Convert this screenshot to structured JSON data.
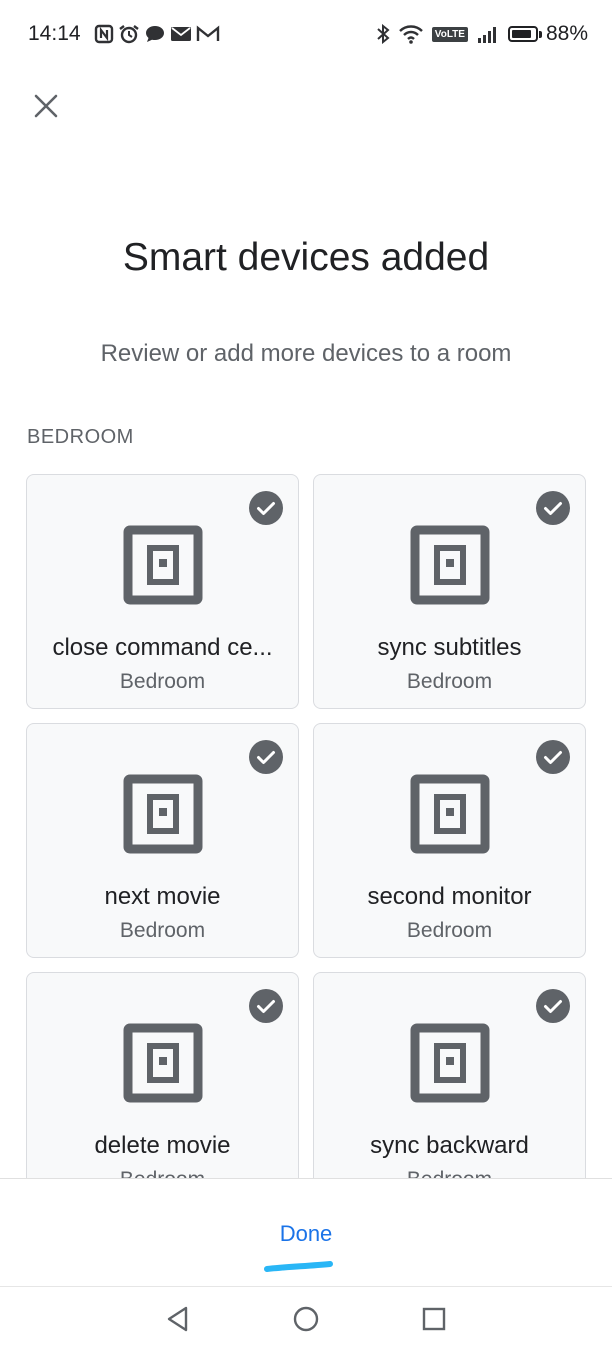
{
  "status_bar": {
    "time": "14:14",
    "left_icons": [
      "nfc-icon",
      "alarm-icon",
      "chat-icon",
      "mail-icon",
      "gmail-icon"
    ],
    "right_icons": [
      "bluetooth-icon",
      "wifi-icon",
      "volte-icon",
      "signal-icon",
      "battery-icon"
    ],
    "volte_label": "VoLTE",
    "battery_percent": "88%",
    "battery_level": 0.88
  },
  "header": {
    "close_icon": "close-icon",
    "title": "Smart devices added",
    "subtitle": "Review or add more devices to a room"
  },
  "section": {
    "label": "BEDROOM"
  },
  "devices": [
    {
      "name": "close command ce...",
      "room": "Bedroom",
      "checked": true
    },
    {
      "name": "sync subtitles",
      "room": "Bedroom",
      "checked": true
    },
    {
      "name": "next movie",
      "room": "Bedroom",
      "checked": true
    },
    {
      "name": "second monitor",
      "room": "Bedroom",
      "checked": true
    },
    {
      "name": "delete movie",
      "room": "Bedroom",
      "checked": true
    },
    {
      "name": "sync backward",
      "room": "Bedroom",
      "checked": true
    }
  ],
  "footer": {
    "done_label": "Done"
  },
  "nav": {
    "icons": [
      "back-icon",
      "home-icon",
      "recents-icon"
    ]
  },
  "colors": {
    "accent": "#1a73e8",
    "check": "#5f6368",
    "device_icon": "#5f6368",
    "scribble": "#29b6f6"
  }
}
